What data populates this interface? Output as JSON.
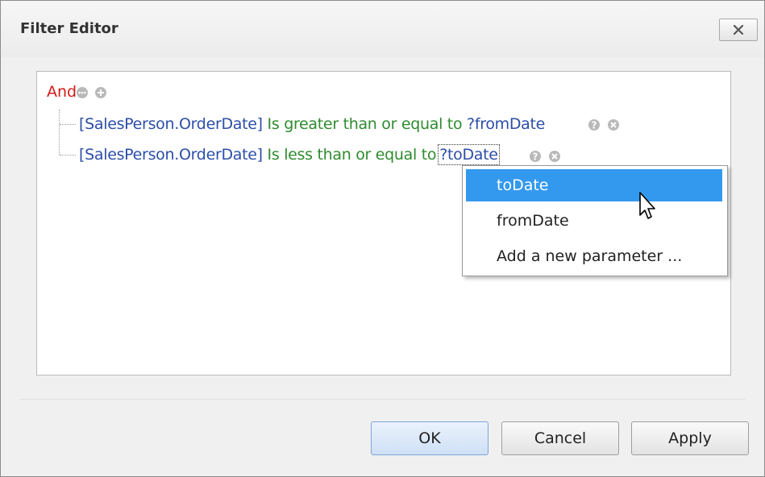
{
  "window": {
    "title": "Filter Editor",
    "close_icon": "close-icon"
  },
  "tree": {
    "root_operator": "And",
    "root_icons": [
      "ellipsis-icon",
      "plus-icon"
    ],
    "conditions": [
      {
        "field": "[SalesPerson.OrderDate]",
        "operator": "Is greater than or equal to",
        "value": "?fromDate",
        "icons": [
          "help-icon",
          "remove-icon"
        ]
      },
      {
        "field": "[SalesPerson.OrderDate]",
        "operator": "Is less than or equal to",
        "value": "?toDate",
        "icons": [
          "help-icon",
          "remove-icon"
        ]
      }
    ]
  },
  "parameter_menu": {
    "items": [
      "toDate",
      "fromDate",
      "Add a new parameter ..."
    ],
    "highlighted_index": 0
  },
  "buttons": {
    "ok": "OK",
    "cancel": "Cancel",
    "apply": "Apply"
  },
  "colors": {
    "operator_and": "#d11b1b",
    "field": "#2c4ea8",
    "condition_operator": "#2e8b2e",
    "menu_highlight": "#3399ee"
  }
}
